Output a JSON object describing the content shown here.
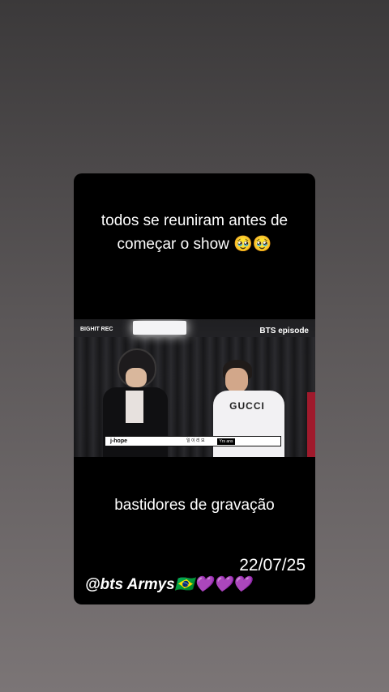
{
  "post": {
    "caption_top": "todos se reuniram antes de começar o show 🥹🥹",
    "caption_middle": "bastidores de gravação",
    "date": "22/07/25",
    "handle": "@bts Armys🇧🇷💜💜💜"
  },
  "video": {
    "logo_left": "BIGHIT REC",
    "logo_right": "BTS episode",
    "name_tag": "j-hope",
    "subtitle_small": "Yrs ans",
    "subtitle_center": "일 이 리 모"
  }
}
